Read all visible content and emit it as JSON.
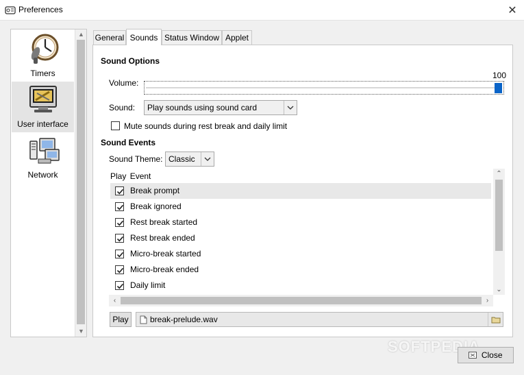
{
  "window": {
    "title": "Preferences"
  },
  "sidebar": {
    "items": [
      {
        "label": "Timers",
        "icon": "clock-icon",
        "selected": false
      },
      {
        "label": "User interface",
        "icon": "monitor-icon",
        "selected": true
      },
      {
        "label": "Network",
        "icon": "network-computers-icon",
        "selected": false
      }
    ]
  },
  "tabs": [
    {
      "label": "General",
      "active": false
    },
    {
      "label": "Sounds",
      "active": true
    },
    {
      "label": "Status Window",
      "active": false
    },
    {
      "label": "Applet",
      "active": false
    }
  ],
  "sound_options": {
    "heading": "Sound Options",
    "volume_label": "Volume:",
    "volume_value": "100",
    "sound_label": "Sound:",
    "sound_selected": "Play sounds using sound card",
    "mute_label": "Mute sounds during rest break and daily limit",
    "mute_checked": false
  },
  "sound_events": {
    "heading": "Sound Events",
    "theme_label": "Sound Theme:",
    "theme_selected": "Classic",
    "columns": [
      "Play",
      "Event"
    ],
    "events": [
      {
        "label": "Break prompt",
        "checked": true
      },
      {
        "label": "Break ignored",
        "checked": true
      },
      {
        "label": "Rest break started",
        "checked": true
      },
      {
        "label": "Rest break ended",
        "checked": true
      },
      {
        "label": "Micro-break started",
        "checked": true
      },
      {
        "label": "Micro-break ended",
        "checked": true
      },
      {
        "label": "Daily limit",
        "checked": true
      }
    ],
    "play_button": "Play",
    "file_name": "break-prelude.wav"
  },
  "footer": {
    "close_label": "Close",
    "watermark": "SOFTPEDIA"
  },
  "colors": {
    "accent": "#0a64c8",
    "highlight_row": "#e8e8e8",
    "selected_sidebar": "#e4e4e4"
  }
}
